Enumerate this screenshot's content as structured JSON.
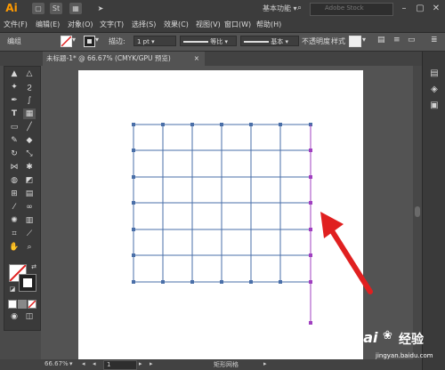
{
  "app": {
    "logo": "Ai",
    "workspace": "基本功能",
    "search_placeholder": "Adobe Stock",
    "icons": [
      "st-icon",
      "layout-icon",
      "send-icon"
    ]
  },
  "menu": [
    "文件(F)",
    "编辑(E)",
    "对象(O)",
    "文字(T)",
    "选择(S)",
    "效果(C)",
    "视图(V)",
    "窗口(W)",
    "帮助(H)"
  ],
  "control": {
    "selection_label": "编组",
    "stroke_label": "描边:",
    "stroke_value": "1 pt",
    "profile_label": "等比",
    "brush_label": "基本",
    "opacity_label": "不透明度",
    "style_label": "样式"
  },
  "tab": {
    "title": "未标题-1* @ 66.67% (CMYK/GPU 预览)",
    "close": "×"
  },
  "status": {
    "zoom": "66.67%",
    "page": "1",
    "tool_name": "矩形网格"
  },
  "watermark": {
    "brand": "Bai",
    "brand2": "经验",
    "url": "jingyan.baidu.com"
  },
  "grid": {
    "columns": 6,
    "rows": 6
  },
  "colors": {
    "grid_line": "#4a6fa8",
    "selection_line": "#a040c0",
    "arrow": "#e02020",
    "accent": "#ff9a00"
  }
}
